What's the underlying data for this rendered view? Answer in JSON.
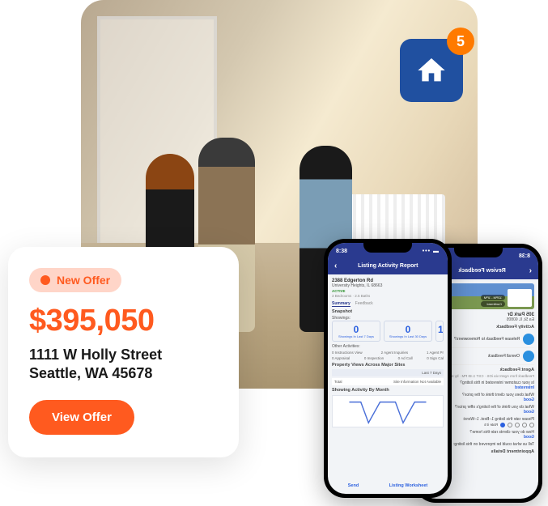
{
  "badge": {
    "count": "5"
  },
  "offer": {
    "pill_label": "New Offer",
    "price": "$395,050",
    "address_line1": "1111 W Holly Street",
    "address_line2": "Seattle, WA 45678",
    "button_label": "View Offer"
  },
  "phone_front": {
    "status_time": "8:38",
    "header_title": "Listing Activity Report",
    "address_line1": "2388 Edgerton Rd",
    "address_line2": "University Heights, IL 68663",
    "status_text": "ACTIVE",
    "meta_text": "3 Bedrooms · 2.5 Baths",
    "tabs": {
      "summary": "Summary",
      "feedback": "Feedback"
    },
    "snapshot_label": "Snapshot",
    "showings_label": "Showings:",
    "stat1": {
      "value": "0",
      "label": "Showings In Last 7 Days"
    },
    "stat2": {
      "value": "0",
      "label": "Showings In Last 30 Days"
    },
    "stat3_glimpse": {
      "value": "1"
    },
    "other_activities_label": "Other Activities:",
    "activities": {
      "r1a": "0 Instructions View",
      "r1b": "2 Agent Inquiries",
      "r1c": "1 Agent Pr",
      "r2a": "0 Appraisal",
      "r2b": "0 Inspection",
      "r2c": "0 Ad Call",
      "r2d": "0 Sign Cal"
    },
    "views_label": "Property Views Across Major Sites",
    "views_row": {
      "total": "Total",
      "last7": "Last 7 Days",
      "info": "Site Information Not Available"
    },
    "monthly_label": "Showing Activity By Month",
    "footer": {
      "send": "Send",
      "worksheet": "Listing Worksheet"
    }
  },
  "phone_back": {
    "status_time": "8:38",
    "header_title": "Review Feedback",
    "tag1": "12PM - 1PM",
    "tag2": "Confirmed",
    "addr1": "305 Park Dr",
    "addr2": "Ea St, IL 60805",
    "activity_header": "Activity Feedback",
    "row1": "Release Feedback to Homeowners?",
    "row2": "Overall Feedback",
    "agent_header": "Agent Feedback",
    "meta": "Feedback from Agent via iOS · CST 1:49 PM · by request",
    "q1": "Is your customer interested in this listing?",
    "a1": "Interested",
    "q2": "What does your client think of the price?",
    "a2": "Good",
    "q3": "What do you think of the listing's offer price?",
    "a3": "Good",
    "q4": "Please rate this listing 1–Best. 1–Worst:",
    "a4": "Rate it 5",
    "q5": "How do your clients rate this home?",
    "a5": "Good",
    "q6": "Tell us what could be improved on this listing:",
    "appt_label": "Appointment Details"
  }
}
